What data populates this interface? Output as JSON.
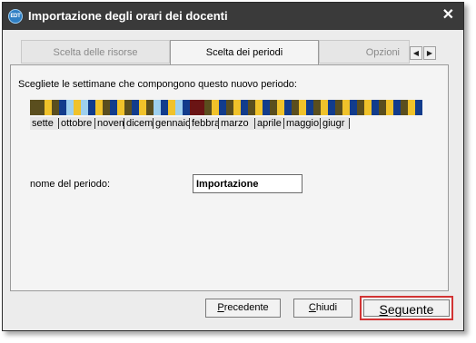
{
  "window": {
    "title": "Importazione degli orari dei docenti",
    "icon_text": "EDT",
    "close_label": "✕"
  },
  "tabs": [
    {
      "label": "Scelta delle risorse",
      "active": false
    },
    {
      "label": "Scelta dei periodi",
      "active": true
    },
    {
      "label": "Opzioni",
      "active": false
    }
  ],
  "tab_scroll": {
    "left": "◀",
    "right": "▶"
  },
  "instruction": "Scegliete le settimane che compongono questo nuovo periodo:",
  "weeks": {
    "colors": {
      "D": "#5a4e1e",
      "Y": "#f0c22a",
      "B": "#123c8c",
      "L": "#9ed0ee",
      "M": "#6a1414",
      "G": "#4a4a4a"
    },
    "pattern": [
      "D",
      "D",
      "Y",
      "D",
      "B",
      "L",
      "Y",
      "L",
      "B",
      "Y",
      "D",
      "B",
      "Y",
      "D",
      "B",
      "Y",
      "D",
      "L",
      "B",
      "Y",
      "L",
      "B",
      "M",
      "M",
      "D",
      "Y",
      "B",
      "D",
      "Y",
      "B",
      "D",
      "Y",
      "B",
      "D",
      "Y",
      "B",
      "D",
      "Y",
      "B",
      "D",
      "Y",
      "B",
      "D",
      "Y",
      "B",
      "D",
      "Y",
      "B",
      "D",
      "Y",
      "B",
      "D",
      "Y",
      "B"
    ]
  },
  "months": [
    "sette",
    "ottobre",
    "novemb",
    "dicemb",
    "gennaio",
    "febbra",
    "marzo",
    "aprile",
    "maggio",
    "giugr"
  ],
  "name_field": {
    "label": "nome del periodo:",
    "value": "Importazione"
  },
  "buttons": {
    "previous": "Precedente",
    "close": "Chiudi",
    "next": "Seguente"
  }
}
